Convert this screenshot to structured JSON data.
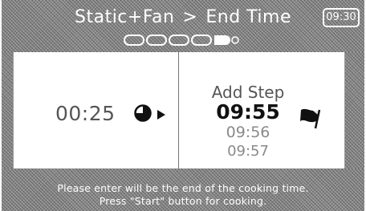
{
  "header": {
    "title_program": "Static+Fan",
    "title_separator": ">",
    "title_mode": "End Time",
    "clock": "09:30"
  },
  "stepper": {
    "total_steps": 5,
    "current_step": 5
  },
  "main": {
    "duration": "00:25",
    "add_step": "Add Step",
    "end_time_selected": "09:55",
    "end_time_next": "09:56",
    "end_time_next2": "09:57"
  },
  "footer": {
    "line1": "Please enter will be the end of the cooking time.",
    "line2": "Press \"Start\" button for cooking."
  },
  "colors": {
    "panel": "#8c8c8c",
    "text_dark": "#111111",
    "text_dim": "#8a8a8a"
  }
}
